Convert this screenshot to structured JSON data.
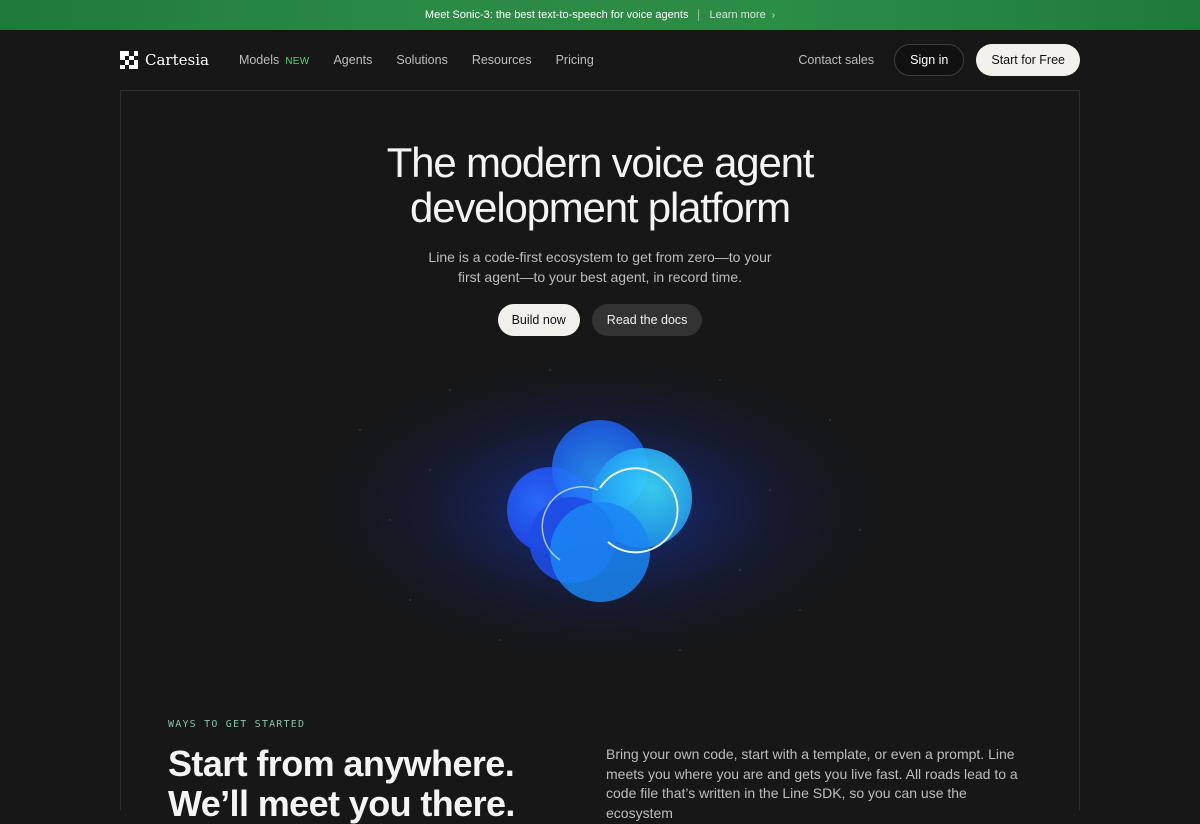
{
  "announcement": {
    "text": "Meet Sonic-3: the best text-to-speech for voice agents",
    "link_label": "Learn more"
  },
  "brand": {
    "name": "Cartesia"
  },
  "nav": {
    "items": [
      {
        "label": "Models",
        "badge": "NEW"
      },
      {
        "label": "Agents"
      },
      {
        "label": "Solutions"
      },
      {
        "label": "Resources"
      },
      {
        "label": "Pricing"
      }
    ],
    "contact_label": "Contact sales",
    "signin_label": "Sign in",
    "start_label": "Start for Free"
  },
  "hero": {
    "title_line1": "The modern voice agent",
    "title_line2": "development platform",
    "subtitle_line1": "Line is a code-first ecosystem to get from zero—to your",
    "subtitle_line2": "first agent—to your best agent, in record time.",
    "primary_cta": "Build now",
    "secondary_cta": "Read the docs"
  },
  "section": {
    "label": "WAYS TO GET STARTED",
    "title_line1": "Start from anywhere.",
    "title_line2": "We’ll meet you there.",
    "body": "Bring your own code, start with a template, or even a prompt. Line meets you where you are and gets you live fast. All roads lead to a code file that’s written in the Line SDK, so you can use the ecosystem"
  },
  "colors": {
    "background": "#171717",
    "announcement_green": "#2b8a45",
    "accent_new": "#4fd17b",
    "orb_blue": "#1a5cff",
    "orb_cyan": "#22c8f0"
  }
}
